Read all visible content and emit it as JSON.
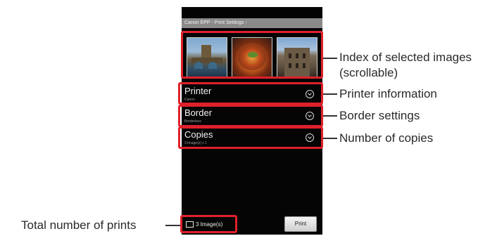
{
  "app": {
    "title": "Canon EPP - Print Settings -"
  },
  "thumbnails": [
    {
      "icon": "bridge-photo"
    },
    {
      "icon": "food-photo"
    },
    {
      "icon": "building-photo"
    }
  ],
  "settings": [
    {
      "label": "Printer",
      "value": "Canon"
    },
    {
      "label": "Border",
      "value": "Borderless"
    },
    {
      "label": "Copies",
      "value": "3 Image(s) x 1"
    }
  ],
  "bottom": {
    "count_label": "3 Image(s)",
    "print_label": "Print"
  },
  "callouts": {
    "index_line1": "Index of selected images",
    "index_line2": "(scrollable)",
    "printer": "Printer information",
    "border": "Border settings",
    "copies": "Number of copies",
    "total": "Total number of prints"
  },
  "colors": {
    "highlight": "#e0202a",
    "screen": "#050505"
  }
}
